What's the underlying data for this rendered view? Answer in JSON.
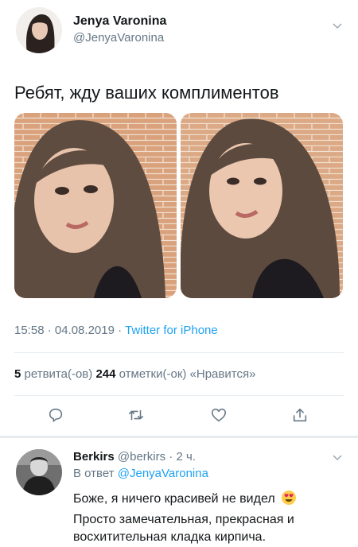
{
  "tweet": {
    "author_name": "Jenya Varonina",
    "author_handle": "@JenyaVaronina",
    "text": "Ребят, жду ваших комплиментов",
    "time": "15:58 · 04.08.2019 · ",
    "source": "Twitter for iPhone",
    "retweets_count": "5",
    "retweets_label": " ретвита(-ов) ",
    "likes_count": "244",
    "likes_label": " отметки(-ок) «Нравится»"
  },
  "actions": [
    "reply-icon",
    "retweet-icon",
    "like-icon",
    "share-icon"
  ],
  "reply": {
    "author_name": "Berkirs",
    "author_handle": "@berkirs",
    "time": " · 2 ч.",
    "reply_to_prefix": "В ответ ",
    "reply_to_handle": "@JenyaVaronina",
    "line1": "Боже, я ничего красивей не видел",
    "line2": "Просто замечательная, прекрасная и",
    "line3": "восхитительная кладка кирпича."
  },
  "colors": {
    "accent": "#1da1f2",
    "secondary": "#657786",
    "text": "#14171a",
    "divider": "#e6ecf0"
  }
}
